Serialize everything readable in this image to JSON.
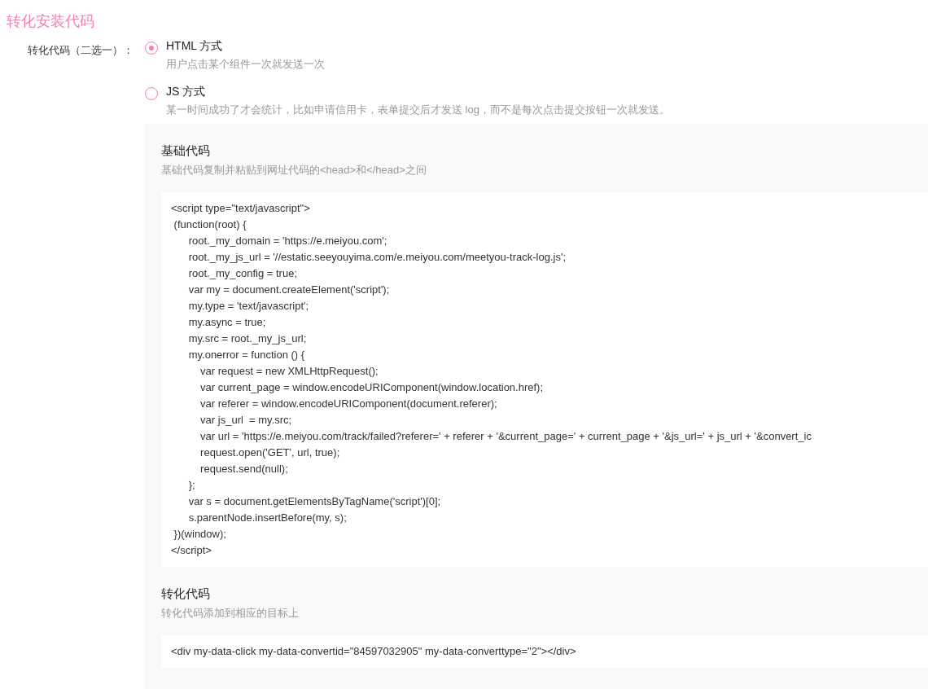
{
  "title": "转化安装代码",
  "field": {
    "label": "转化代码（二选一）：",
    "options": [
      {
        "label": "HTML 方式",
        "description": "用户点击某个组件一次就发送一次",
        "selected": true
      },
      {
        "label": "JS 方式",
        "description": "某一时间成功了才会统计，比如申请信用卡，表单提交后才发送 log，而不是每次点击提交按钮一次就发送。",
        "selected": false
      }
    ]
  },
  "sections": [
    {
      "title": "基础代码",
      "description": "基础代码复制并粘贴到网址代码的<head>和</head>之间",
      "code": [
        "<script type=\"text/javascript\">",
        " (function(root) {",
        "      root._my_domain = 'https://e.meiyou.com';",
        "      root._my_js_url = '//estatic.seeyouyima.com/e.meiyou.com/meetyou-track-log.js';",
        "      root._my_config = true;",
        "      var my = document.createElement('script');",
        "      my.type = 'text/javascript';",
        "      my.async = true;",
        "      my.src = root._my_js_url;",
        "      my.onerror = function () {",
        "          var request = new XMLHttpRequest();",
        "          var current_page = window.encodeURIComponent(window.location.href);",
        "          var referer = window.encodeURIComponent(document.referer);",
        "          var js_url  = my.src;",
        "          var url = 'https://e.meiyou.com/track/failed?referer=' + referer + '&current_page=' + current_page + '&js_url=' + js_url + '&convert_ic",
        "          request.open('GET', url, true);",
        "          request.send(null);",
        "      };",
        "      var s = document.getElementsByTagName('script')[0];",
        "      s.parentNode.insertBefore(my, s);",
        " })(window);",
        "</script>"
      ]
    },
    {
      "title": "转化代码",
      "description": "转化代码添加到相应的目标上",
      "code": [
        "<div my-data-click my-data-convertid=\"84597032905\" my-data-converttype=\"2\"></div>"
      ]
    }
  ]
}
